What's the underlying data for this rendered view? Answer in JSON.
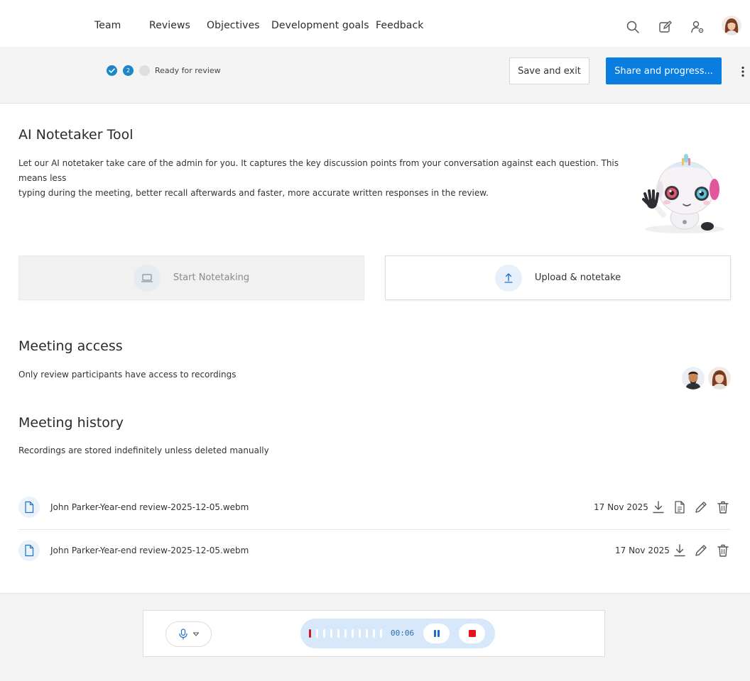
{
  "nav": {
    "items": [
      "Team",
      "Reviews",
      "Objectives",
      "Development goals",
      "Feedback"
    ]
  },
  "progress": {
    "step_2_number": "2",
    "status_label": "Ready for review",
    "save_exit_label": "Save and exit",
    "share_label": "Share and progress..."
  },
  "notetaker": {
    "title": "AI Notetaker Tool",
    "description_line1": "Let our AI notetaker take care of the admin for you. It captures the key discussion points from your conversation against each question. This means less",
    "description_line2": "typing during the meeting, better recall afterwards and faster, more accurate written responses in the review.",
    "start_label": "Start Notetaking",
    "upload_label": "Upload & notetake"
  },
  "access": {
    "title": "Meeting access",
    "description": "Only review participants have access to recordings"
  },
  "history": {
    "title": "Meeting history",
    "description": "Recordings are stored indefinitely unless deleted manually",
    "rows": [
      {
        "file": "John Parker-Year-end review-2025-12-05.webm",
        "date": "17 Nov 2025"
      },
      {
        "file": "John Parker-Year-end review-2025-12-05.webm",
        "date": "17 Nov 2025"
      }
    ]
  },
  "recorder": {
    "timer": "00:06",
    "level_bars_active": 1,
    "level_bars_total": 11
  },
  "colors": {
    "primary": "#0a7de0",
    "step_done": "#1c86c8",
    "record_red": "#e3111b",
    "recorder_bg": "#d6e8fa"
  }
}
